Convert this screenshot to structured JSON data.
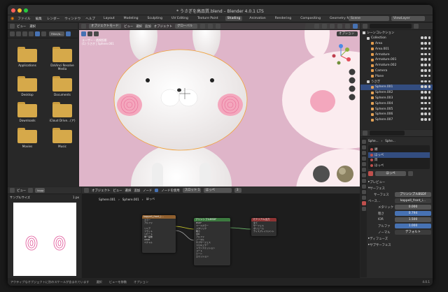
{
  "window": {
    "title": "* うさぎを高品質.blend – Blender 4.0.1 LTS"
  },
  "menu": {
    "items": [
      "ファイル",
      "編集",
      "レンダー",
      "ウィンドウ",
      "ヘルプ"
    ]
  },
  "workspaces": {
    "tabs": [
      "Layout",
      "Modeling",
      "Sculpting",
      "UV Editing",
      "Texture Paint",
      "Shading",
      "Animation",
      "Rendering",
      "Compositing",
      "Geometry Nodes",
      "Scripting"
    ],
    "active": "Shading"
  },
  "scene": {
    "label": "Scene",
    "view_layer": "ViewLayer"
  },
  "file_browser": {
    "header": [
      "ビュー",
      "選択"
    ],
    "filter_placeholder": "Filter/b...",
    "folders": [
      {
        "name": "Applications"
      },
      {
        "name": "DaVinci Resolve Media"
      },
      {
        "name": "Desktop"
      },
      {
        "name": "Documents"
      },
      {
        "name": "Downloads"
      },
      {
        "name": "iCloud Drive...(ア)"
      },
      {
        "name": "Movies"
      },
      {
        "name": "Music"
      }
    ]
  },
  "viewport": {
    "mode": "オブジェクトモード",
    "menus": [
      "ビュー",
      "選択",
      "追加",
      "オブジェクト"
    ],
    "transform": "グローバル",
    "overlay_text": "ユーザー・透視投影\n(1) うさぎ | Sphere.001",
    "options_label": "オプション"
  },
  "image_editor": {
    "header": [
      "ビュー"
    ],
    "image_name": "kopp",
    "sample_label": "サンプルサイズ",
    "sample_value": "1 px"
  },
  "node_editor": {
    "object": "オブジェクト",
    "menus": [
      "ビュー",
      "選択",
      "追加",
      "ノード"
    ],
    "use_nodes_label": "ノードを使用",
    "slot": "スロット 1",
    "material": "ほっぺ",
    "users": "3",
    "breadcrumb": [
      "Sphere.001",
      "Sphere.001",
      "ほっぺ"
    ],
    "nodes": {
      "image": {
        "title": "koppell_front_i...",
        "rows": [
          "カラー",
          "アルファ",
          "",
          "リニア",
          "フラット",
          "リピート",
          "単一画像",
          "sRGB",
          "ベクトル"
        ]
      },
      "bsdf": {
        "title": "プリンシプルBSDF",
        "rows": [
          "BSDF",
          "ベースカラー",
          "メタリック",
          "粗さ",
          "IOR",
          "アルファ",
          "ノーマル",
          "サブサーフェス",
          "スペキュラー",
          "トランスミッション",
          "コート",
          "シーン",
          "エミッション"
        ]
      },
      "output": {
        "title": "マテリアル出力",
        "rows": [
          "全て",
          "サーフェス",
          "ボリューム",
          "ディスプレイスメント"
        ]
      }
    }
  },
  "outliner": {
    "title": "シーンコレクション",
    "items": [
      {
        "name": "Collection",
        "indent": 1
      },
      {
        "name": "Area",
        "indent": 2
      },
      {
        "name": "Area.001",
        "indent": 2
      },
      {
        "name": "Armature",
        "indent": 2
      },
      {
        "name": "Armature.001",
        "indent": 2
      },
      {
        "name": "Armature.002",
        "indent": 2
      },
      {
        "name": "Camera",
        "indent": 2
      },
      {
        "name": "Plane",
        "indent": 2
      },
      {
        "name": "うさぎ",
        "indent": 1
      },
      {
        "name": "Sphere.001",
        "indent": 2
      },
      {
        "name": "Sphere.002",
        "indent": 2
      },
      {
        "name": "Sphere.003",
        "indent": 2
      },
      {
        "name": "Sphere.004",
        "indent": 2
      },
      {
        "name": "Sphere.005",
        "indent": 2
      },
      {
        "name": "Sphere.006",
        "indent": 2
      },
      {
        "name": "Sphere.007",
        "indent": 2
      }
    ],
    "selected": "Sphere.001"
  },
  "properties": {
    "breadcrumb": [
      "Sphe...",
      "Sphe..."
    ],
    "material_slots": [
      "頭",
      "ほっぺ",
      "目",
      "ほっぺ"
    ],
    "active_slot": "ほっぺ",
    "material_name": "ほっぺ",
    "sections": {
      "preview": "プレビュー",
      "surface": "サーフェス"
    },
    "surface_label": "サーフェス",
    "surface_value": "プリンシプルBSDF",
    "base_color_label": "ベース...",
    "base_color_value": "koppell_front_i...",
    "fields": [
      {
        "label": "メタリック",
        "value": "0.000",
        "highlight": false
      },
      {
        "label": "粗さ",
        "value": "0.794",
        "highlight": true
      },
      {
        "label": "IOR",
        "value": "1.500",
        "highlight": false
      },
      {
        "label": "アルファ",
        "value": "1.000",
        "highlight": true
      }
    ],
    "normal_label": "ノーマル",
    "normal_value": "デフォルト",
    "subsections": [
      "ディフューズ",
      "サブサーフェス"
    ]
  },
  "status": {
    "left": "アクティブなオブジェクトに別のスケールが含まれています",
    "select": "選択",
    "pan": "ビューを移動",
    "options": "オプション",
    "version": "4.0.1"
  },
  "colors": {
    "accent": "#4772b3",
    "header": "#303030",
    "panel": "#262626",
    "pink_bg": "#dfb5c9"
  }
}
